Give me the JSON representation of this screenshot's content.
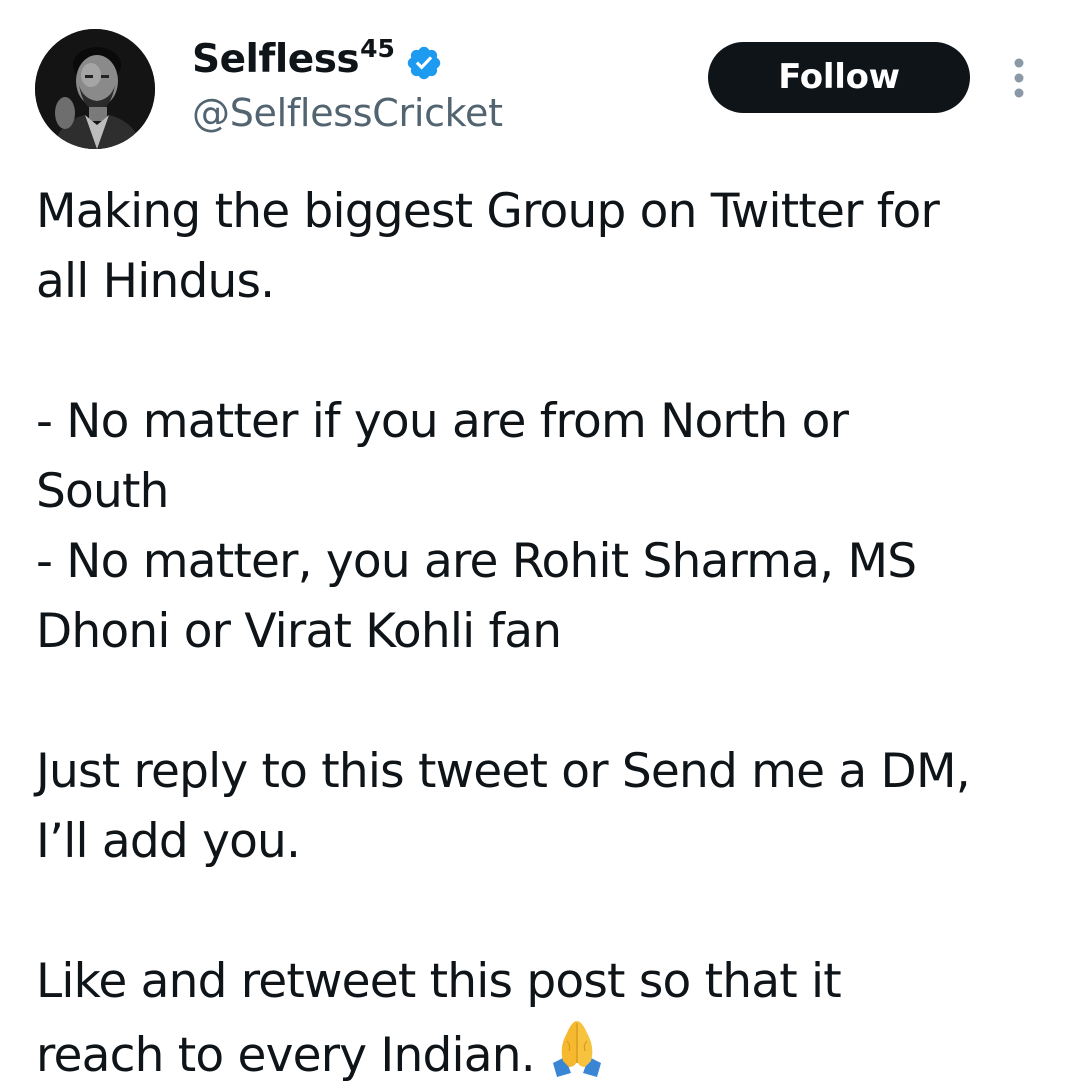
{
  "author": {
    "display_name": "Selfless",
    "display_name_sup": "45",
    "handle": "@SelflessCricket",
    "verified_icon": "verified-badge-icon",
    "verified_color": "#1d9bf0"
  },
  "actions": {
    "follow_label": "Follow",
    "more_icon": "more-vertical-icon"
  },
  "tweet": {
    "paragraphs": [
      {
        "lines": [
          "Making the biggest Group on Twitter for",
          "all Hindus."
        ]
      },
      {
        "lines": [
          "- No matter if you are from North or",
          "South",
          "- No matter, you are Rohit Sharma, MS",
          "Dhoni or Virat Kohli fan"
        ]
      },
      {
        "lines": [
          "Just reply to this tweet or Send me a DM,",
          "I’ll add you."
        ]
      },
      {
        "lines": [
          "Like and retweet this post so that it",
          "reach to every Indian."
        ],
        "emoji": "folded-hands-emoji"
      }
    ]
  },
  "colors": {
    "text": "#0f1419",
    "secondary_text": "#536471",
    "follow_bg": "#0f1419",
    "follow_text": "#ffffff",
    "more_icon": "#8b98a5"
  }
}
